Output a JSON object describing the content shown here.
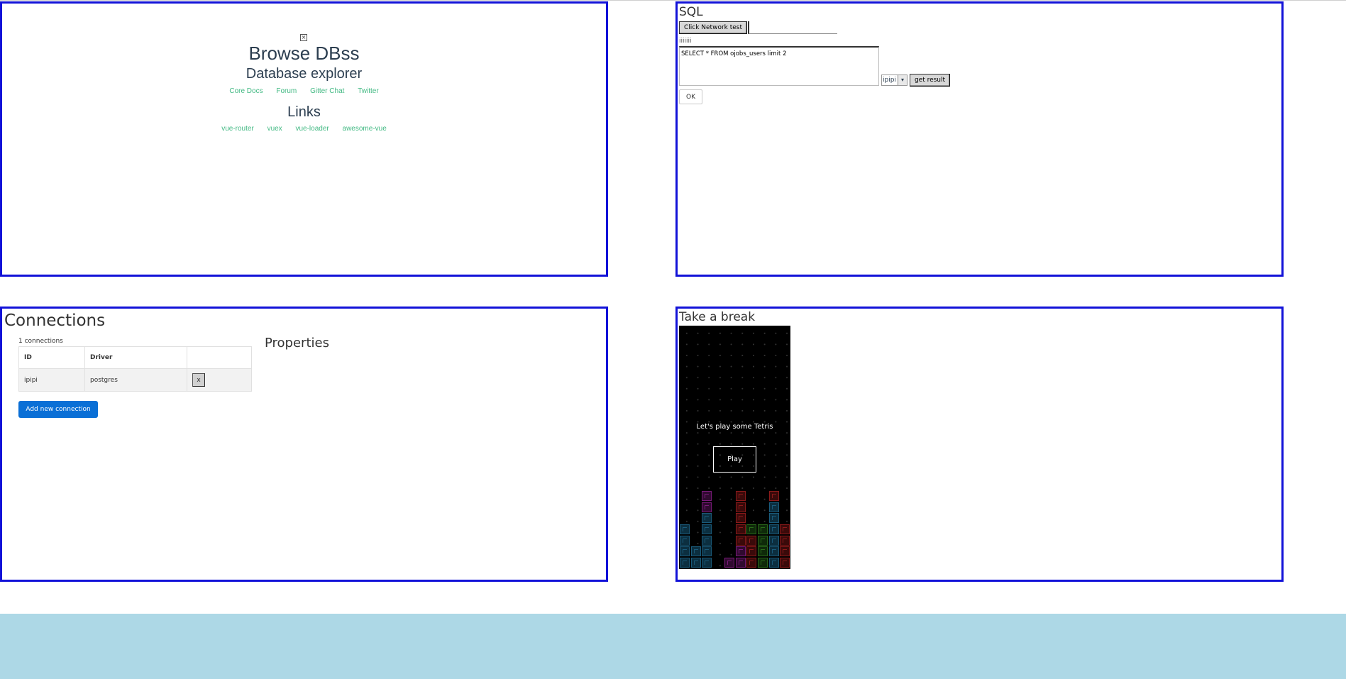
{
  "panel_home": {
    "title": "Browse DBss",
    "subtitle": "Database explorer",
    "essential_links": [
      "Core Docs",
      "Forum",
      "Gitter Chat",
      "Twitter"
    ],
    "links_heading": "Links",
    "ecosystem_links": [
      "vue-router",
      "vuex",
      "vue-loader",
      "awesome-vue"
    ]
  },
  "panel_sql": {
    "title": "SQL",
    "network_button": "Click Network test",
    "network_input_value": "",
    "label": "iiiiiii",
    "query": "SELECT * FROM ojobs_users limit 2",
    "connection_select": "ipipi",
    "result_button": "get result",
    "ok_button": "OK"
  },
  "panel_connections": {
    "title": "Connections",
    "count_text": "1 connections",
    "columns": [
      "ID",
      "Driver",
      ""
    ],
    "rows": [
      {
        "id": "ipipi",
        "driver": "postgres",
        "action": "x"
      }
    ],
    "add_button": "Add new connection",
    "properties_title": "Properties"
  },
  "panel_break": {
    "title": "Take a break",
    "message": "Let's play some Tetris",
    "play_button": "Play"
  },
  "colors": {
    "panel_border": "#1212d8",
    "link_green": "#42b983",
    "primary_button": "#0a6fd6",
    "footer": "#add8e6"
  }
}
